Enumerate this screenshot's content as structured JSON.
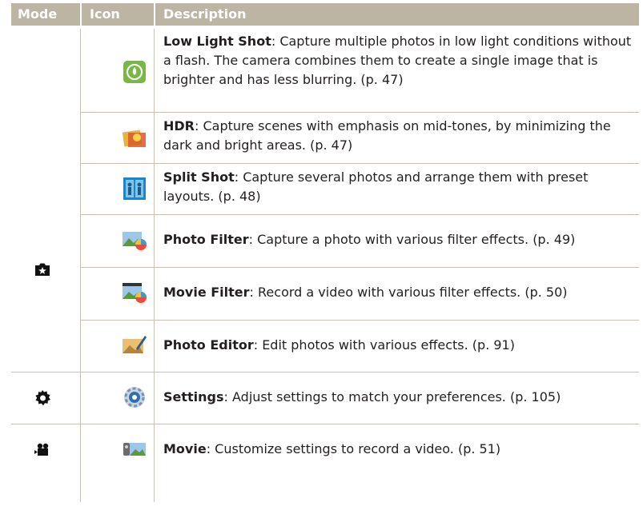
{
  "header": {
    "mode": "Mode",
    "icon": "Icon",
    "description": "Description"
  },
  "rows": [
    {
      "title": "Low Light Shot",
      "text": ": Capture multiple photos in low light conditions without a flash. The camera combines them to create a single image that is brighter and has less blurring. (p. 47)",
      "icon": "low-light-shot-icon"
    },
    {
      "title": "HDR",
      "text": ": Capture scenes with emphasis on mid-tones, by minimizing the dark and bright areas. (p. 47)",
      "icon": "hdr-icon"
    },
    {
      "title": "Split Shot",
      "text": ": Capture several photos and arrange them with preset layouts. (p. 48)",
      "icon": "split-shot-icon"
    },
    {
      "title": "Photo Filter",
      "text": ": Capture a photo with various filter effects. (p. 49)",
      "icon": "photo-filter-icon"
    },
    {
      "title": "Movie Filter",
      "text": ": Record a video with various filter effects. (p. 50)",
      "icon": "movie-filter-icon"
    },
    {
      "title": "Photo Editor",
      "text": ": Edit photos with various effects. (p. 91)",
      "icon": "photo-editor-icon"
    },
    {
      "title": "Settings",
      "text": ": Adjust settings to match your preferences. (p. 105)",
      "icon": "settings-icon"
    },
    {
      "title": "Movie",
      "text": ": Customize settings to record a video. (p. 51)",
      "icon": "movie-icon"
    }
  ],
  "modes": [
    {
      "icon": "camera-star-mode-icon"
    },
    {
      "icon": "gear-mode-icon"
    },
    {
      "icon": "video-camera-mode-icon"
    }
  ],
  "colors": {
    "header_bg": "#bdb5a4",
    "grid": "#c8c2b4",
    "text": "#231f20"
  }
}
